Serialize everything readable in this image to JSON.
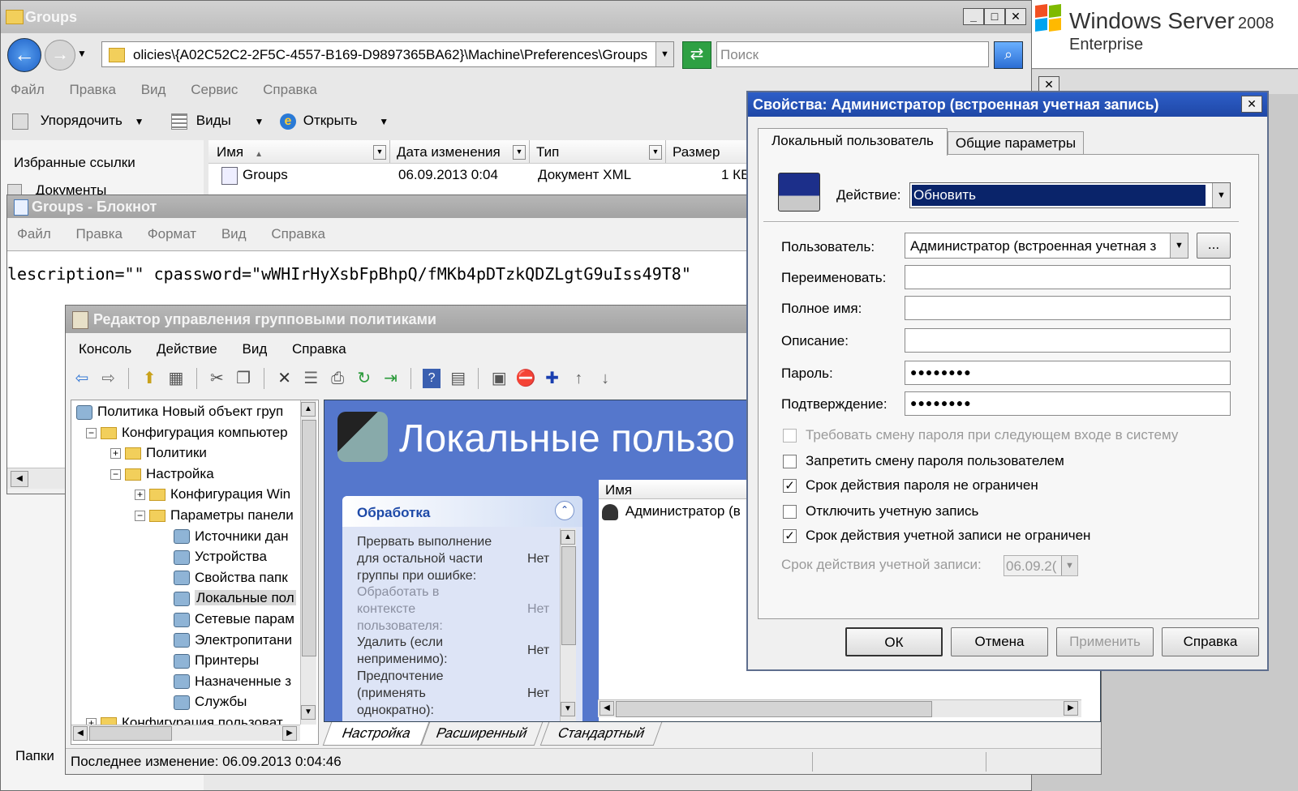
{
  "branding": {
    "os_name": "Windows Server",
    "os_version": "2008",
    "edition": "Enterprise"
  },
  "explorer": {
    "title": "Groups",
    "address": "olicies\\{A02C52C2-2F5C-4557-B169-D9897365BA62}\\Machine\\Preferences\\Groups",
    "search_placeholder": "Поиск",
    "menu": [
      "Файл",
      "Правка",
      "Вид",
      "Сервис",
      "Справка"
    ],
    "toolbar": {
      "organize": "Упорядочить",
      "views": "Виды",
      "open": "Открыть"
    },
    "nav": {
      "favorites": "Избранные ссылки",
      "documents": "Документы",
      "folders": "Папки"
    },
    "columns": [
      "Имя",
      "Дата изменения",
      "Тип",
      "Размер"
    ],
    "rows": [
      {
        "name": "Groups",
        "date": "06.09.2013 0:04",
        "type": "Документ XML",
        "size": "1 КБ"
      }
    ]
  },
  "notepad": {
    "title": "Groups - Блокнот",
    "menu": [
      "Файл",
      "Правка",
      "Формат",
      "Вид",
      "Справка"
    ],
    "content": "lescription=\"\" cpassword=\"wWHIrHyXsbFpBhpQ/fMKb4pDTzkQDZLgtG9uIss49T8\""
  },
  "gpme": {
    "title": "Редактор управления групповыми политиками",
    "menu": [
      "Консоль",
      "Действие",
      "Вид",
      "Справка"
    ],
    "tree": [
      {
        "label": "Политика Новый объект груп",
        "level": 0,
        "toggle": ""
      },
      {
        "label": "Конфигурация компьютер",
        "level": 1,
        "toggle": "−"
      },
      {
        "label": "Политики",
        "level": 2,
        "toggle": "+"
      },
      {
        "label": "Настройка",
        "level": 2,
        "toggle": "−"
      },
      {
        "label": "Конфигурация Win",
        "level": 3,
        "toggle": "+"
      },
      {
        "label": "Параметры панели",
        "level": 3,
        "toggle": "−"
      },
      {
        "label": "Источники дан",
        "level": 4,
        "toggle": ""
      },
      {
        "label": "Устройства",
        "level": 4,
        "toggle": ""
      },
      {
        "label": "Свойства папк",
        "level": 4,
        "toggle": ""
      },
      {
        "label": "Локальные пол",
        "level": 4,
        "toggle": "",
        "selected": true
      },
      {
        "label": "Сетевые парам",
        "level": 4,
        "toggle": ""
      },
      {
        "label": "Электропитани",
        "level": 4,
        "toggle": ""
      },
      {
        "label": "Принтеры",
        "level": 4,
        "toggle": ""
      },
      {
        "label": "Назначенные з",
        "level": 4,
        "toggle": ""
      },
      {
        "label": "Службы",
        "level": 4,
        "toggle": ""
      },
      {
        "label": "Конфигурация пользоват",
        "level": 1,
        "toggle": "+"
      }
    ],
    "banner": "Локальные пользо",
    "processing_title": "Обработка",
    "processing_items": [
      {
        "label": "Прервать выполнение для остальной части группы при ошибке:",
        "value": "Нет"
      },
      {
        "label": "Обработать в контексте пользователя:",
        "value": "Нет"
      },
      {
        "label": "Удалить (если неприменимо):",
        "value": "Нет"
      },
      {
        "label": "Предпочтение (применять однократно):",
        "value": "Нет"
      }
    ],
    "list_header": "Имя",
    "list_items": [
      "Администратор (в"
    ],
    "tabs": [
      "Настройка",
      "Расширенный",
      "Стандартный"
    ],
    "status": "Последнее изменение: 06.09.2013 0:04:46"
  },
  "dialog": {
    "title": "Свойства: Администратор (встроенная учетная запись)",
    "tabs": [
      "Локальный пользователь",
      "Общие параметры"
    ],
    "action_label": "Действие:",
    "action_value": "Обновить",
    "user_label": "Пользователь:",
    "user_value": "Администратор (встроенная учетная з",
    "browse": "...",
    "rename_label": "Переименовать:",
    "fullname_label": "Полное имя:",
    "description_label": "Описание:",
    "password_label": "Пароль:",
    "password_value": "●●●●●●●●",
    "confirm_label": "Подтверждение:",
    "confirm_value": "●●●●●●●●",
    "checkboxes": [
      {
        "label": "Требовать смену пароля при следующем входе в систему",
        "checked": false,
        "disabled": true
      },
      {
        "label": "Запретить смену пароля пользователем",
        "checked": false,
        "disabled": false
      },
      {
        "label": "Срок действия пароля не ограничен",
        "checked": true,
        "disabled": false
      },
      {
        "label": "Отключить учетную запись",
        "checked": false,
        "disabled": false
      },
      {
        "label": "Срок действия учетной записи не ограничен",
        "checked": true,
        "disabled": false
      }
    ],
    "expiry_label": "Срок действия учетной записи:",
    "expiry_value": "06.09.2(",
    "buttons": {
      "ok": "ОК",
      "cancel": "Отмена",
      "apply": "Применить",
      "help": "Справка"
    }
  }
}
